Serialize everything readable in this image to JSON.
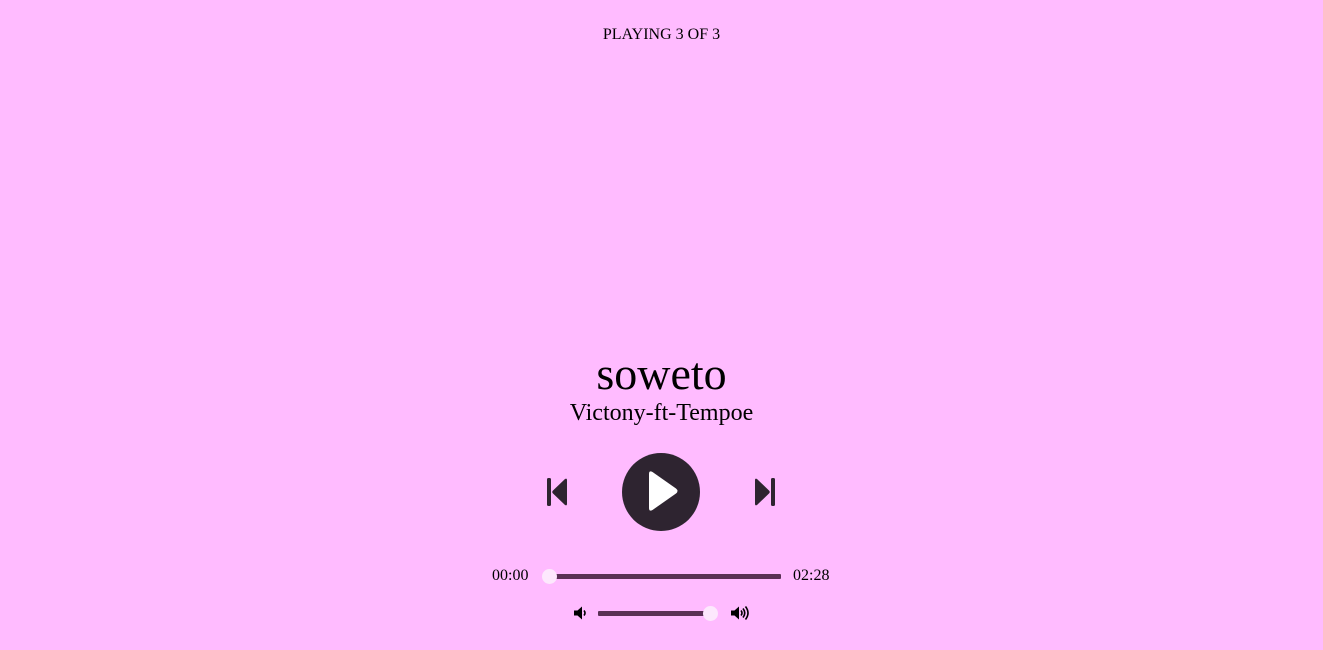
{
  "header": {
    "now_playing": "PLAYING 3 OF 3"
  },
  "track": {
    "title": "soweto",
    "artist": "Victony-ft-Tempoe"
  },
  "controls": {
    "prev_icon": "skip-previous-icon",
    "play_icon": "play-icon",
    "next_icon": "skip-next-icon"
  },
  "seek": {
    "current_time": "00:00",
    "total_time": "02:28",
    "progress_fraction": 0.02
  },
  "volume": {
    "down_icon": "volume-down-icon",
    "up_icon": "volume-up-icon",
    "level_fraction": 0.94
  },
  "colors": {
    "background": "#ffbbff",
    "accent": "#2e2430",
    "track": "#5a3055",
    "thumb": "#fde8fd"
  }
}
